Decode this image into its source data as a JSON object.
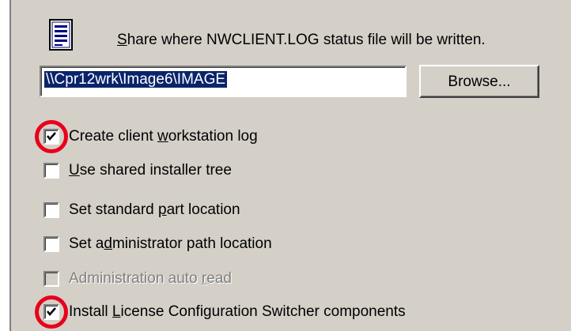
{
  "header": {
    "description_pre": "",
    "description_accel": "S",
    "description_post": "hare where NWCLIENT.LOG status file will be written.",
    "icon": "document-icon"
  },
  "path_field": {
    "value": "\\\\Cpr12wrk\\Image6\\IMAGE"
  },
  "browse_button": {
    "label": "Browse..."
  },
  "options": [
    {
      "pre": "Create client ",
      "accel": "w",
      "post": "orkstation log",
      "checked": true,
      "enabled": true
    },
    {
      "pre": "",
      "accel": "U",
      "post": "se shared installer tree",
      "checked": false,
      "enabled": true
    },
    {
      "pre": "Set standard ",
      "accel": "p",
      "post": "art location",
      "checked": false,
      "enabled": true
    },
    {
      "pre": "Set a",
      "accel": "d",
      "post": "ministrator path location",
      "checked": false,
      "enabled": true
    },
    {
      "pre": "Administration auto ",
      "accel": "r",
      "post": "ead",
      "checked": false,
      "enabled": false
    },
    {
      "pre": "Install ",
      "accel": "L",
      "post": "icense Configuration Switcher components",
      "checked": true,
      "enabled": true
    }
  ],
  "annotations": {
    "circle_color": "#e8001c",
    "arrow_color": "#e8001c"
  }
}
